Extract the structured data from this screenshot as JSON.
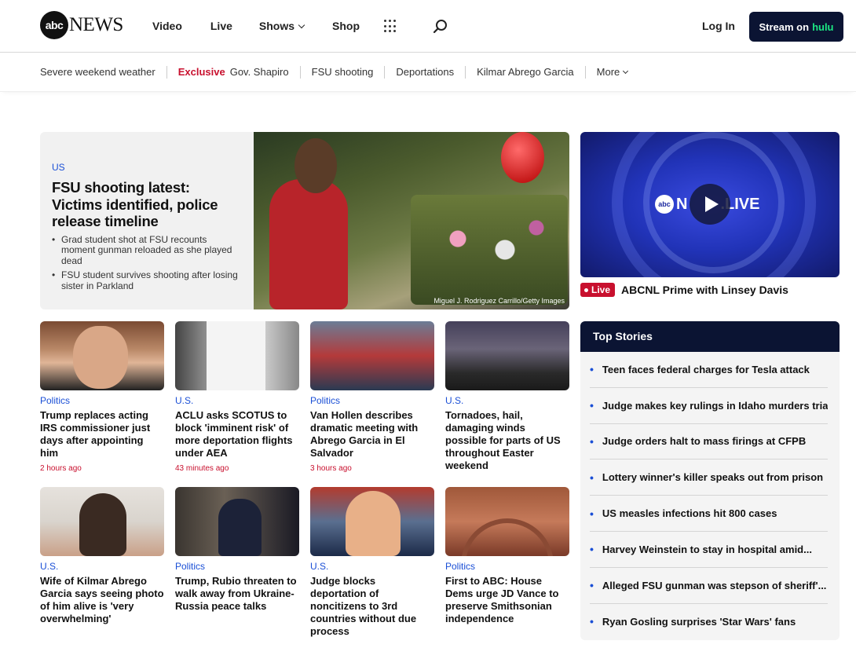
{
  "header": {
    "logo_mark": "abc",
    "logo_text": "NEWS",
    "nav": [
      {
        "label": "Video"
      },
      {
        "label": "Live"
      },
      {
        "label": "Shows"
      },
      {
        "label": "Shop"
      }
    ],
    "login_label": "Log In",
    "stream_label": "Stream on",
    "stream_brand": "hulu",
    "brand_color": "#1ce783"
  },
  "trending": {
    "items": [
      "Severe weekend weather",
      "Gov. Shapiro",
      "FSU shooting",
      "Deportations",
      "Kilmar Abrego Garcia"
    ],
    "exclusive_label": "Exclusive",
    "more_label": "More"
  },
  "hero": {
    "category": "US",
    "title": "FSU shooting latest: Victims identified, police release timeline",
    "bullets": [
      "Grad student shot at FSU recounts moment gunman reloaded as she played dead",
      "FSU student survives shooting after losing sister in Parkland"
    ],
    "credit": "Miguel J. Rodriguez Carrillo/Getty Images"
  },
  "live": {
    "logo_mark": "abc",
    "logo_n": "N",
    "logo_live": ".LIVE",
    "badge": "Live",
    "title": "ABCNL Prime with Linsey Davis"
  },
  "cards": [
    {
      "category": "Politics",
      "title": "Trump replaces acting IRS commissioner just days after appointing him",
      "time": "2 hours ago"
    },
    {
      "category": "U.S.",
      "title": "ACLU asks SCOTUS to block 'imminent risk' of more deportation flights under AEA",
      "time": "43 minutes ago"
    },
    {
      "category": "Politics",
      "title": "Van Hollen describes dramatic meeting with Abrego Garcia in El Salvador",
      "time": "3 hours ago"
    },
    {
      "category": "U.S.",
      "title": "Tornadoes, hail, damaging winds possible for parts of US throughout Easter weekend",
      "time": ""
    },
    {
      "category": "U.S.",
      "title": "Wife of Kilmar Abrego Garcia says seeing photo of him alive is 'very overwhelming'",
      "time": ""
    },
    {
      "category": "Politics",
      "title": "Trump, Rubio threaten to walk away from Ukraine-Russia peace talks",
      "time": ""
    },
    {
      "category": "U.S.",
      "title": "Judge blocks deportation of noncitizens to 3rd countries without due process",
      "time": ""
    },
    {
      "category": "Politics",
      "title": "First to ABC: House Dems urge JD Vance to preserve Smithsonian independence",
      "time": ""
    }
  ],
  "top_stories": {
    "title": "Top Stories",
    "items": [
      "Teen faces federal charges for Tesla attack",
      "Judge makes key rulings in Idaho murders trial",
      "Judge orders halt to mass firings at CFPB",
      "Lottery winner's killer speaks out from prison",
      "US measles infections hit 800 cases",
      "Harvey Weinstein to stay in hospital amid...",
      "Alleged FSU gunman was stepson of sheriff'...",
      "Ryan Gosling surprises 'Star Wars' fans"
    ]
  },
  "colors": {
    "accent_blue": "#1a4fd6",
    "accent_red": "#c8102e",
    "navy": "#0b1433"
  }
}
